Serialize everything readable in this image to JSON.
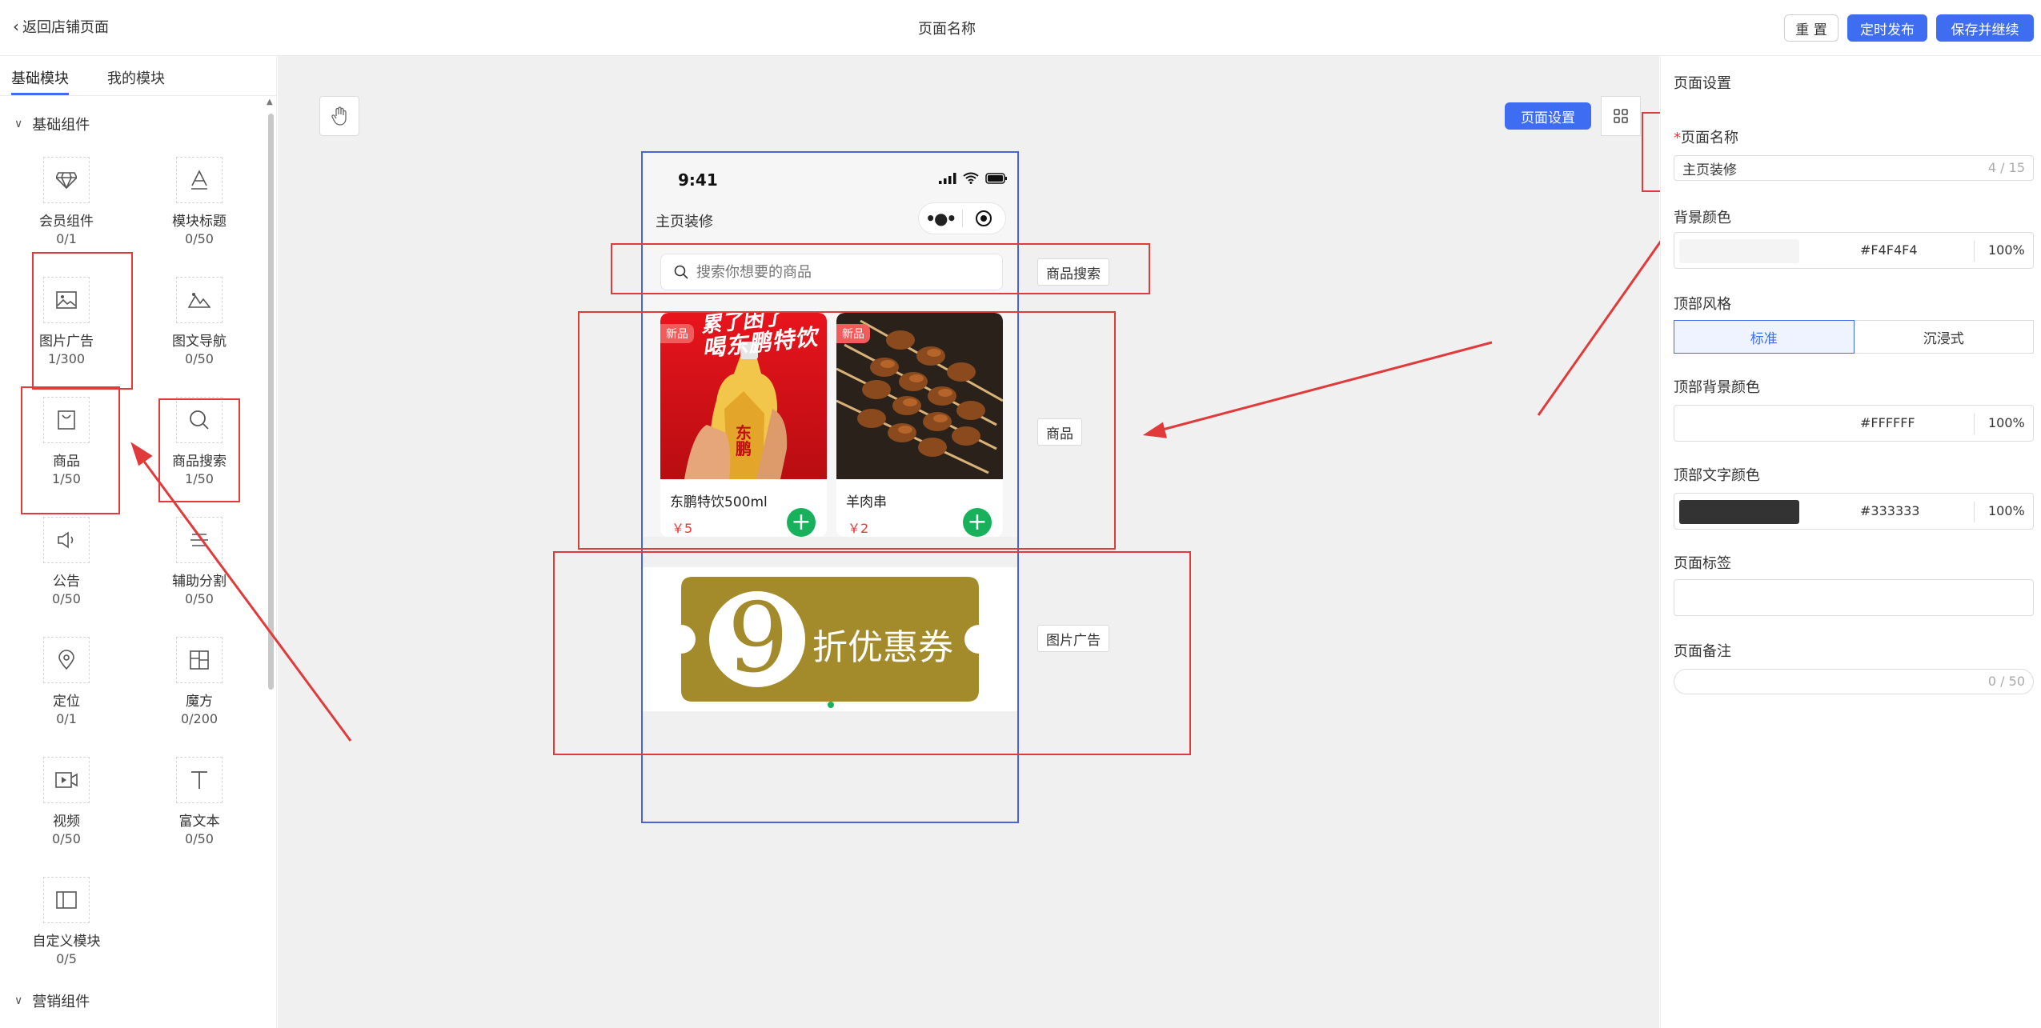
{
  "header": {
    "back_label": "返回店铺页面",
    "page_title": "页面名称",
    "reset_label": "重 置",
    "timed_publish_label": "定时发布",
    "save_continue_label": "保存并继续"
  },
  "left_panel": {
    "tabs": [
      {
        "label": "基础模块",
        "active": true
      },
      {
        "label": "我的模块",
        "active": false
      }
    ],
    "basic_group_title": "基础组件",
    "marketing_group_title": "营销组件",
    "components": [
      {
        "name": "会员组件",
        "count": "0/1",
        "icon": "diamond-icon"
      },
      {
        "name": "模块标题",
        "count": "0/50",
        "icon": "text-a-icon"
      },
      {
        "name": "图片广告",
        "count": "1/300",
        "icon": "image-icon"
      },
      {
        "name": "图文导航",
        "count": "0/50",
        "icon": "mountain-icon"
      },
      {
        "name": "商品",
        "count": "1/50",
        "icon": "bag-icon"
      },
      {
        "name": "商品搜索",
        "count": "1/50",
        "icon": "search-icon"
      },
      {
        "name": "公告",
        "count": "0/50",
        "icon": "speaker-icon"
      },
      {
        "name": "辅助分割",
        "count": "0/50",
        "icon": "divider-icon"
      },
      {
        "name": "定位",
        "count": "0/1",
        "icon": "location-icon"
      },
      {
        "name": "魔方",
        "count": "0/200",
        "icon": "cube-grid-icon"
      },
      {
        "name": "视频",
        "count": "0/50",
        "icon": "video-icon"
      },
      {
        "name": "富文本",
        "count": "0/50",
        "icon": "text-t-icon"
      },
      {
        "name": "自定义模块",
        "count": "0/5",
        "icon": "layout-icon"
      }
    ]
  },
  "canvas": {
    "page_settings_label": "页面设置",
    "phone": {
      "time": "9:41",
      "title": "主页装修",
      "search_placeholder": "搜索你想要的商品",
      "products": [
        {
          "name": "东鹏特饮500ml",
          "price": "￥5",
          "badge": "新品"
        },
        {
          "name": "羊肉串",
          "price": "￥2",
          "badge": "新品"
        }
      ],
      "drink_banner_text": "喝东鹏特饮",
      "drink_banner_top": "累了困了",
      "bottle_brand": "东鹏",
      "coupon_number": "9",
      "coupon_text": "折优惠券"
    },
    "side_labels": {
      "search": "商品搜索",
      "goods": "商品",
      "image_ad": "图片广告"
    }
  },
  "right_panel": {
    "title": "页面设置",
    "page_name_label": "页面名称",
    "required_mark": "*",
    "page_name_value": "主页装修",
    "page_name_counter": "4 / 15",
    "bg_color_label": "背景颜色",
    "bg_color_hex": "#F4F4F4",
    "bg_color_pct": "100%",
    "top_style_label": "顶部风格",
    "top_style_options": [
      "标准",
      "沉浸式"
    ],
    "top_bg_label": "顶部背景颜色",
    "top_bg_hex": "#FFFFFF",
    "top_bg_pct": "100%",
    "top_text_label": "顶部文字颜色",
    "top_text_hex": "#333333",
    "top_text_pct": "100%",
    "page_tag_label": "页面标签",
    "page_note_label": "页面备注",
    "page_note_counter": "0 / 50"
  },
  "colors": {
    "accent": "#3f6df2",
    "annotation_red": "#e03a3a",
    "add_green": "#16b15a",
    "coupon_gold": "#a38a2a"
  }
}
